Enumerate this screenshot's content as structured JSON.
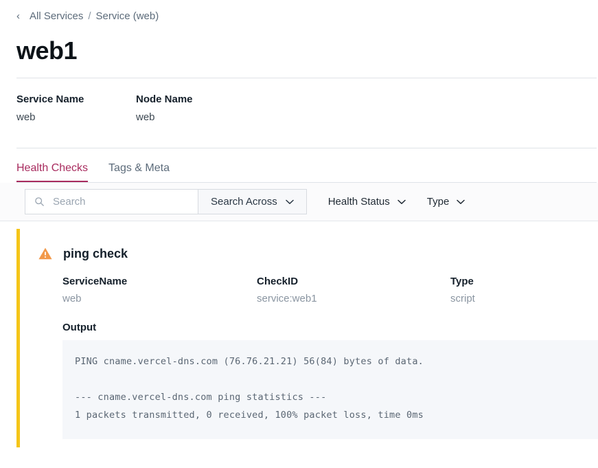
{
  "breadcrumb": {
    "back_icon": "chevron-left-icon",
    "parent": "All Services",
    "separator": "/",
    "current": "Service (web)"
  },
  "page_title": "web1",
  "meta": {
    "fields": [
      {
        "label": "Service Name",
        "value": "web"
      },
      {
        "label": "Node Name",
        "value": "web"
      }
    ]
  },
  "tabs": [
    {
      "label": "Health Checks",
      "active": true
    },
    {
      "label": "Tags & Meta",
      "active": false
    }
  ],
  "filters": {
    "search": {
      "icon": "search-icon",
      "placeholder": "Search",
      "value": ""
    },
    "search_across": {
      "label": "Search Across",
      "icon": "chevron-down-icon"
    },
    "health_status": {
      "label": "Health Status",
      "icon": "chevron-down-icon"
    },
    "type": {
      "label": "Type",
      "icon": "chevron-down-icon"
    }
  },
  "check": {
    "status_icon": "warning-triangle-icon",
    "accent_color": "#f5c518",
    "warning_color": "#f2994a",
    "title": "ping check",
    "fields": [
      {
        "label": "ServiceName",
        "value": "web"
      },
      {
        "label": "CheckID",
        "value": "service:web1"
      },
      {
        "label": "Type",
        "value": "script"
      }
    ],
    "output_label": "Output",
    "output_lines": [
      "PING cname.vercel-dns.com (76.76.21.21) 56(84) bytes of data.",
      "",
      "--- cname.vercel-dns.com ping statistics ---",
      "1 packets transmitted, 0 received, 100% packet loss, time 0ms"
    ]
  },
  "colors": {
    "accent_tab": "#a82b5e",
    "link": "#5c6b7a",
    "output_bg": "#f5f7fa"
  }
}
